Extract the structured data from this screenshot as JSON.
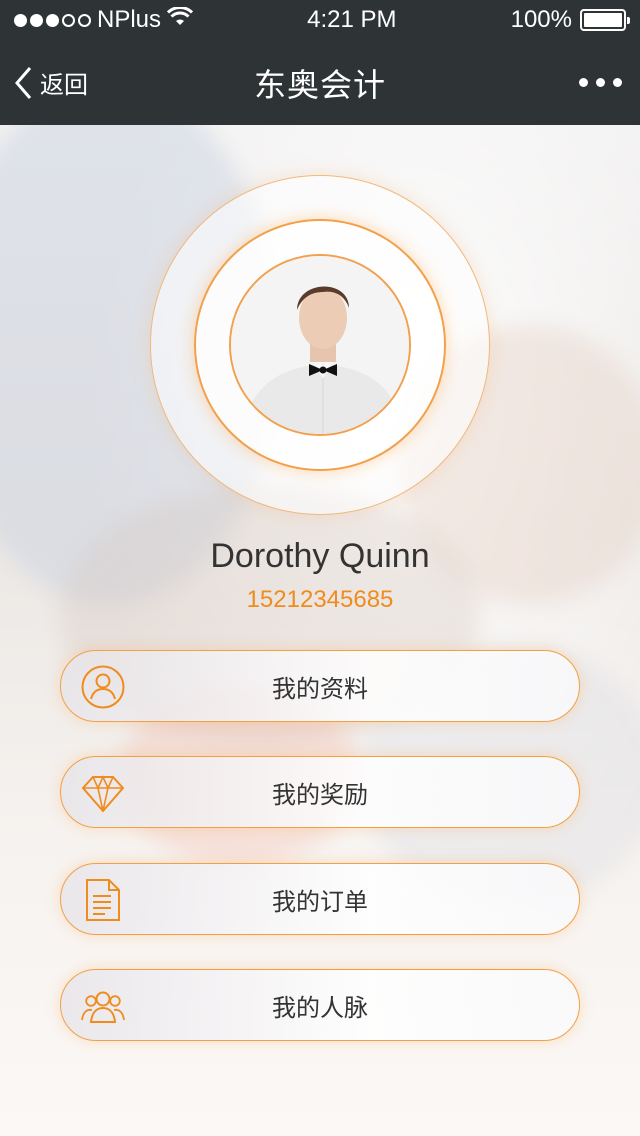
{
  "status_bar": {
    "carrier": "NPlus",
    "time": "4:21 PM",
    "battery": "100%"
  },
  "nav": {
    "back_label": "返回",
    "title": "东奥会计"
  },
  "profile": {
    "name": "Dorothy Quinn",
    "phone": "15212345685"
  },
  "menu": [
    {
      "label": "我的资料",
      "icon": "user-icon"
    },
    {
      "label": "我的奖励",
      "icon": "diamond-icon"
    },
    {
      "label": "我的订单",
      "icon": "document-icon"
    },
    {
      "label": "我的人脉",
      "icon": "people-icon"
    }
  ],
  "colors": {
    "bar": "#2e3436",
    "accent": "#f08b1e"
  }
}
